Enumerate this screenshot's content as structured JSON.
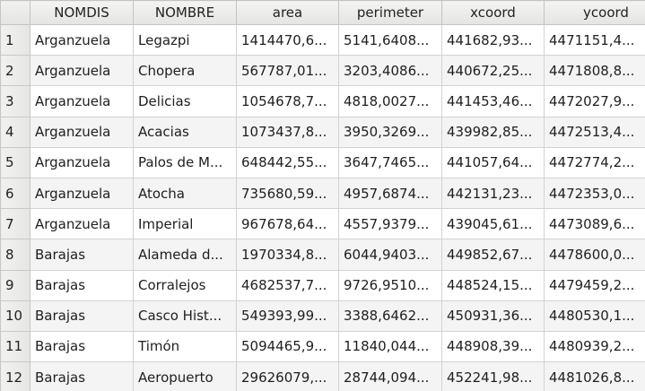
{
  "columns": [
    "NOMDIS",
    "NOMBRE",
    "area",
    "perimeter",
    "xcoord",
    "ycoord"
  ],
  "rows": [
    {
      "num": "1",
      "nomdis": "Arganzuela",
      "nombre": "Legazpi",
      "area": "1414470,6...",
      "perimeter": "5141,6408...",
      "xcoord": "441682,93...",
      "ycoord": "4471151,4..."
    },
    {
      "num": "2",
      "nomdis": "Arganzuela",
      "nombre": "Chopera",
      "area": "567787,01...",
      "perimeter": "3203,4086...",
      "xcoord": "440672,25...",
      "ycoord": "4471808,8..."
    },
    {
      "num": "3",
      "nomdis": "Arganzuela",
      "nombre": "Delicias",
      "area": "1054678,7...",
      "perimeter": "4818,0027...",
      "xcoord": "441453,46...",
      "ycoord": "4472027,9..."
    },
    {
      "num": "4",
      "nomdis": "Arganzuela",
      "nombre": "Acacias",
      "area": "1073437,8...",
      "perimeter": "3950,3269...",
      "xcoord": "439982,85...",
      "ycoord": "4472513,4..."
    },
    {
      "num": "5",
      "nomdis": "Arganzuela",
      "nombre": "Palos de M...",
      "area": "648442,55...",
      "perimeter": "3647,7465...",
      "xcoord": "441057,64...",
      "ycoord": "4472774,2..."
    },
    {
      "num": "6",
      "nomdis": "Arganzuela",
      "nombre": "Atocha",
      "area": "735680,59...",
      "perimeter": "4957,6874...",
      "xcoord": "442131,23...",
      "ycoord": "4472353,0..."
    },
    {
      "num": "7",
      "nomdis": "Arganzuela",
      "nombre": "Imperial",
      "area": "967678,64...",
      "perimeter": "4557,9379...",
      "xcoord": "439045,61...",
      "ycoord": "4473089,6..."
    },
    {
      "num": "8",
      "nomdis": "Barajas",
      "nombre": "Alameda d...",
      "area": "1970334,8...",
      "perimeter": "6044,9403...",
      "xcoord": "449852,67...",
      "ycoord": "4478600,0..."
    },
    {
      "num": "9",
      "nomdis": "Barajas",
      "nombre": "Corralejos",
      "area": "4682537,7...",
      "perimeter": "9726,9510...",
      "xcoord": "448524,15...",
      "ycoord": "4479459,2..."
    },
    {
      "num": "10",
      "nomdis": "Barajas",
      "nombre": "Casco Hist...",
      "area": "549393,99...",
      "perimeter": "3388,6462...",
      "xcoord": "450931,36...",
      "ycoord": "4480530,1..."
    },
    {
      "num": "11",
      "nomdis": "Barajas",
      "nombre": "Timón",
      "area": "5094465,9...",
      "perimeter": "11840,044...",
      "xcoord": "448908,39...",
      "ycoord": "4480939,2..."
    },
    {
      "num": "12",
      "nomdis": "Barajas",
      "nombre": "Aeropuerto",
      "area": "29626079,...",
      "perimeter": "28744,094...",
      "xcoord": "452241,98...",
      "ycoord": "4481026,8..."
    }
  ]
}
